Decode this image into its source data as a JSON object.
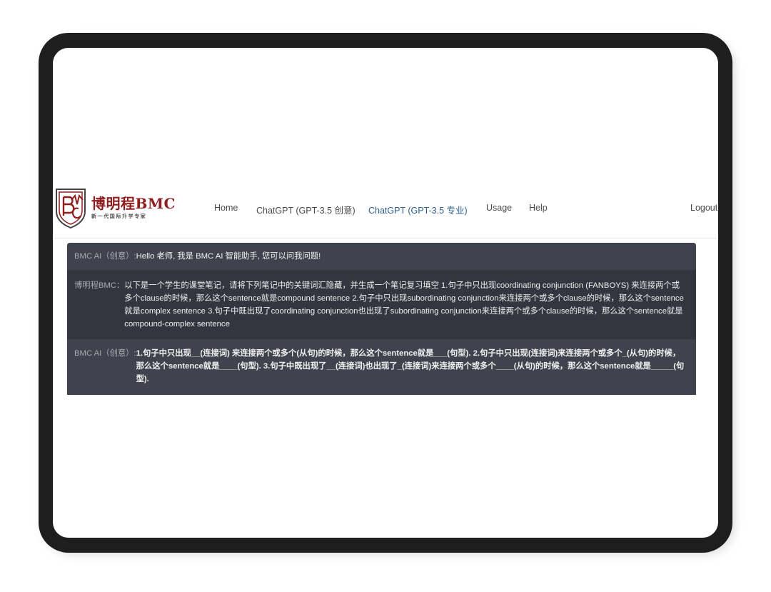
{
  "nav": {
    "logo_title": "博明程BMC",
    "logo_subtitle": "新一代国际升学专家",
    "links": [
      {
        "label": "Home"
      },
      {
        "label": "ChatGPT (GPT-3.5 创意)"
      },
      {
        "label": "ChatGPT (GPT-3.5 专业)"
      },
      {
        "label": "Usage"
      },
      {
        "label": "Help"
      }
    ],
    "logout": "Logout"
  },
  "colors": {
    "brand": "#8f1e1e",
    "active_link": "#2f5f8f",
    "chat_bg": "#40424d",
    "chat_user_bg": "#34363f"
  },
  "chat": {
    "messages": [
      {
        "sender": "BMC AI（创意）:",
        "text": "Hello 老师, 我是 BMC AI 智能助手, 您可以问我问题!"
      },
      {
        "sender": "博明程BMC：",
        "text": "以下是一个学生的课堂笔记，请将下列笔记中的关键词汇隐藏，并生成一个笔记复习填空 1.句子中只出现coordinating conjunction (FANBOYS) 来连接两个或多个clause的时候，那么这个sentence就是compound sentence 2.句子中只出现subordinating conjunction来连接两个或多个clause的时候，那么这个sentence就是complex sentence 3.句子中既出现了coordinating conjunction也出现了subordinating conjunction来连接两个或多个clause的时候，那么这个sentence就是compound-complex sentence"
      },
      {
        "sender": "BMC AI（创意）:",
        "text": "1.句子中只出现__(连接词) 来连接两个或多个(从句)的时候，那么这个sentence就是___(句型). 2.句子中只出现(连接词)来连接两个或多个_(从句)的时候，那么这个sentence就是____(句型). 3.句子中既出现了__(连接词)也出现了_(连接词)来连接两个或多个____(从句)的时候，那么这个sentence就是_____(句型)."
      }
    ]
  }
}
